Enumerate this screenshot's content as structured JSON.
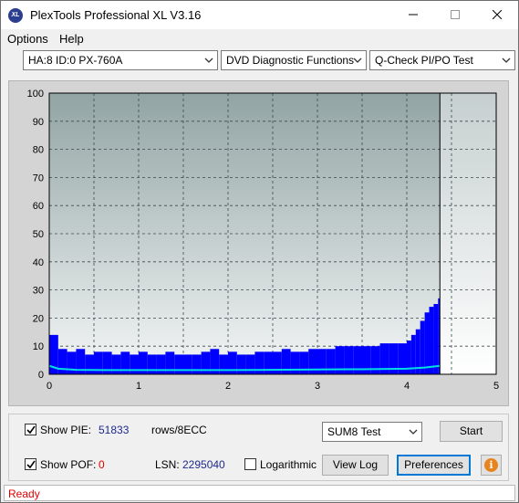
{
  "window": {
    "title": "PlexTools Professional XL V3.16",
    "icon_label": "XL"
  },
  "menu": {
    "options": "Options",
    "help": "Help"
  },
  "selectors": {
    "drive": "HA:8 ID:0  PX-760A",
    "function": "DVD Diagnostic Functions",
    "test": "Q-Check PI/PO Test"
  },
  "chart_data": {
    "type": "bar",
    "x": {
      "min": 0,
      "max": 5,
      "ticks": [
        "0",
        "1",
        "2",
        "3",
        "4",
        "5"
      ]
    },
    "y": {
      "min": 0,
      "max": 100,
      "ticks": [
        "0",
        "10",
        "20",
        "30",
        "40",
        "50",
        "60",
        "70",
        "80",
        "90",
        "100"
      ]
    },
    "grid": true,
    "data_end_x": 4.37,
    "series": [
      {
        "style": "bars",
        "color": "#0000ff",
        "x": [
          0.0,
          0.1,
          0.2,
          0.3,
          0.4,
          0.5,
          0.6,
          0.7,
          0.8,
          0.9,
          1.0,
          1.1,
          1.2,
          1.3,
          1.4,
          1.5,
          1.6,
          1.7,
          1.8,
          1.9,
          2.0,
          2.1,
          2.2,
          2.3,
          2.4,
          2.5,
          2.6,
          2.7,
          2.8,
          2.9,
          3.0,
          3.1,
          3.2,
          3.3,
          3.4,
          3.5,
          3.6,
          3.7,
          3.8,
          3.9,
          4.0,
          4.05,
          4.1,
          4.15,
          4.2,
          4.25,
          4.3,
          4.35
        ],
        "values": [
          14,
          9,
          8,
          9,
          7,
          8,
          8,
          7,
          8,
          7,
          8,
          7,
          7,
          8,
          7,
          7,
          7,
          8,
          9,
          7,
          8,
          7,
          7,
          8,
          8,
          8,
          9,
          8,
          8,
          9,
          9,
          9,
          10,
          10,
          10,
          10,
          10,
          11,
          11,
          11,
          12,
          14,
          16,
          19,
          22,
          24,
          25,
          27
        ]
      },
      {
        "style": "line",
        "color": "#00e0e0",
        "x": [
          0.0,
          0.1,
          0.3,
          0.6,
          1.0,
          1.5,
          2.0,
          2.5,
          3.0,
          3.5,
          4.0,
          4.2,
          4.37
        ],
        "values": [
          3,
          2,
          1.6,
          1.5,
          1.5,
          1.5,
          1.5,
          1.6,
          1.7,
          1.8,
          2.0,
          2.4,
          3.0
        ]
      }
    ]
  },
  "controls": {
    "show_pie_label": "Show PIE:",
    "pie_value": "51833",
    "pie_unit": "rows/8ECC",
    "show_pof_label": "Show POF:",
    "pof_value": "0",
    "lsn_label": "LSN:",
    "lsn_value": "2295040",
    "logarithmic_label": "Logarithmic",
    "test_select": "SUM8 Test",
    "start_label": "Start",
    "viewlog_label": "View Log",
    "preferences_label": "Preferences",
    "info_icon": "info-icon"
  },
  "status": {
    "text": "Ready"
  }
}
